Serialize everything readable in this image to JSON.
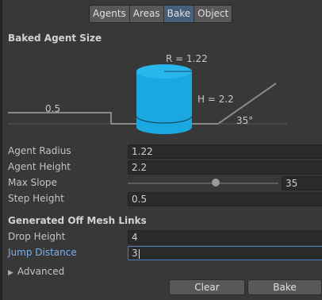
{
  "tabs": [
    {
      "label": "Agents"
    },
    {
      "label": "Areas"
    },
    {
      "label": "Bake"
    },
    {
      "label": "Object"
    }
  ],
  "active_tab": "Bake",
  "baked_agent_size": {
    "title": "Baked Agent Size",
    "radius_label": "R = 1.22",
    "height_label": "H = 2.2",
    "step_label": "0.5",
    "slope_label": "35°"
  },
  "fields": {
    "agent_radius": {
      "label": "Agent Radius",
      "value": "1.22"
    },
    "agent_height": {
      "label": "Agent Height",
      "value": "2.2"
    },
    "max_slope": {
      "label": "Max Slope",
      "value": "35",
      "min": 0,
      "max": 60
    },
    "step_height": {
      "label": "Step Height",
      "value": "0.5"
    }
  },
  "off_mesh_links": {
    "title": "Generated Off Mesh Links",
    "drop_height": {
      "label": "Drop Height",
      "value": "4"
    },
    "jump_distance": {
      "label": "Jump Distance",
      "value": "3"
    }
  },
  "advanced": {
    "label": "Advanced"
  },
  "buttons": {
    "clear": "Clear",
    "bake": "Bake"
  },
  "colors": {
    "agent_cylinder": "#1ba7e0",
    "active_tab": "#46607c",
    "focus_label": "#7ab0f0"
  }
}
